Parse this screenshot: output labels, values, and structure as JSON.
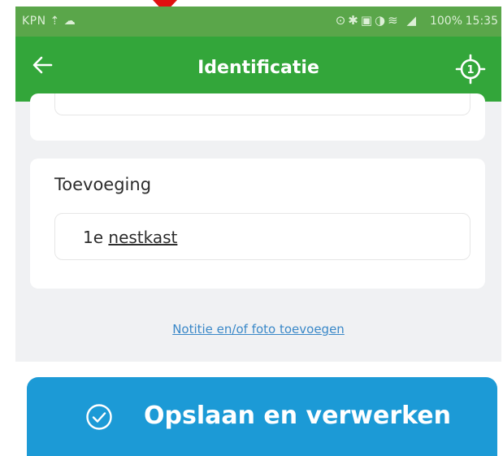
{
  "status_bar": {
    "carrier": "KPN ⇡ ☁",
    "icons": "⊙✱▣◑≋ ◢",
    "battery": "100%",
    "time": "15:35"
  },
  "app_bar": {
    "back_icon": "arrow-left-icon",
    "title": "Identificatie",
    "location_icon": "crosshair-icon",
    "location_badge": "1"
  },
  "form": {
    "field_label": "Toevoeging",
    "field_value_prefix": "1e",
    "field_value_word": "nestkast"
  },
  "note_link": "Notitie en/of foto toevoegen",
  "save_button": {
    "label": "Opslaan en verwerken",
    "icon": "check-circle-icon"
  },
  "colors": {
    "status_bar": "#5aa64a",
    "app_bar": "#33a63a",
    "content_bg": "#f0f1f3",
    "link": "#3a88c8",
    "button": "#1c9ad6",
    "pointer": "#e01010"
  }
}
